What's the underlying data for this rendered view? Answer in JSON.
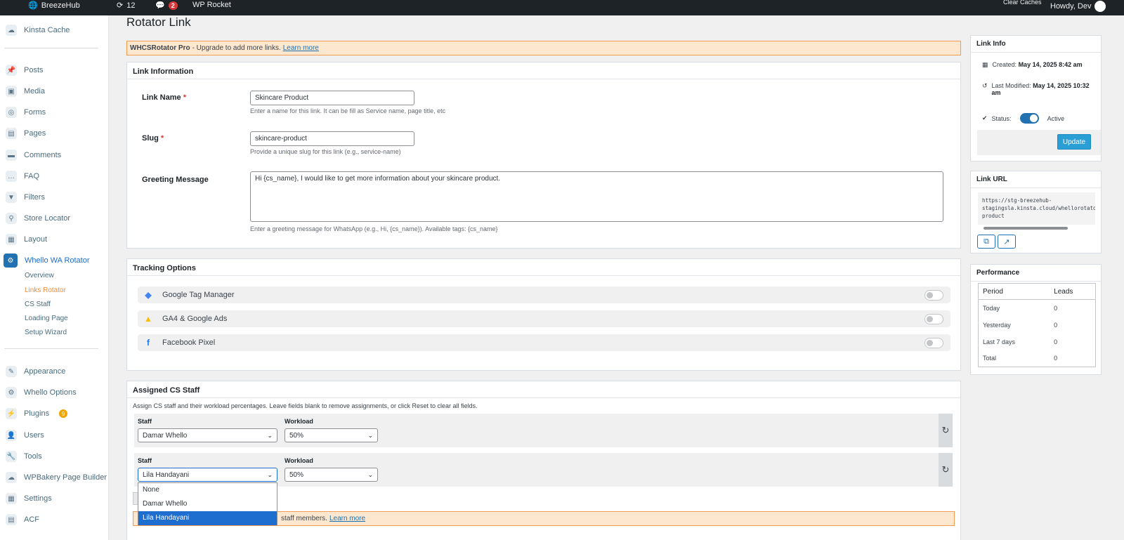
{
  "topbar": {
    "site": "BreezeHub",
    "updates": "12",
    "comments": "2",
    "rocket": "WP Rocket",
    "clear": "Clear Caches",
    "howdy": "Howdy, Dev"
  },
  "sidebar": {
    "kinsta": "Kinsta Cache",
    "items": [
      "Posts",
      "Media",
      "Forms",
      "Pages",
      "Comments",
      "FAQ",
      "Filters",
      "Store Locator",
      "Layout"
    ],
    "active": "Whello WA Rotator",
    "subs": [
      "Overview",
      "Links Rotator",
      "CS Staff",
      "Loading Page",
      "Setup Wizard"
    ],
    "items2": [
      "Appearance",
      "Whello Options",
      "Plugins",
      "Users",
      "Tools",
      "WPBakery Page Builder",
      "Settings",
      "ACF"
    ],
    "plugins_badge": "9"
  },
  "page": {
    "title": "Rotator Link",
    "notice_brand": "WHCSRotator Pro",
    "notice_text": " - Upgrade to add more links.",
    "notice_link": "Learn more"
  },
  "link_info_box": {
    "header": "Link Information",
    "name_label": "Link Name",
    "name_value": "Skincare Product",
    "name_help": "Enter a name for this link. It can be fill as Service name, page title, etc",
    "slug_label": "Slug",
    "slug_value": "skincare-product",
    "slug_help": "Provide a unique slug for this link (e.g., service-name)",
    "greet_label": "Greeting Message",
    "greet_value": "Hi {cs_name}, I would like to get more information about your skincare product.",
    "greet_help": "Enter a greeting message for WhatsApp (e.g., Hi, {cs_name}). Available tags: {cs_name}",
    "required_mark": "*"
  },
  "tracking": {
    "header": "Tracking Options",
    "items": [
      "Google Tag Manager",
      "GA4 & Google Ads",
      "Facebook Pixel"
    ]
  },
  "staff": {
    "header": "Assigned CS Staff",
    "intro": "Assign CS staff and their workload percentages. Leave fields blank to remove assignments, or click Reset to clear all fields.",
    "staff_label": "Staff",
    "workload_label": "Workload",
    "row1_staff": "Damar Whello",
    "row1_workload": "50%",
    "row2_staff": "Lila Handayani",
    "row2_workload": "50%",
    "dropdown": [
      "None",
      "Damar Whello",
      "Lila Handayani"
    ],
    "notice_text": "staff members.",
    "notice_link": "Learn more"
  },
  "right": {
    "info_header": "Link Info",
    "created_label": "Created:",
    "created_value": "May 14, 2025 8:42 am",
    "modified_label": "Last Modified:",
    "modified_value": "May 14, 2025 10:32",
    "modified_value2": "am",
    "status_label": "Status:",
    "status_value": "Active",
    "update": "Update",
    "url_header": "Link URL",
    "url_line1": "https://stg-breezehub-",
    "url_line2": "stagingsla.kinsta.cloud/whellorotator/skincare-",
    "url_line3": "product",
    "perf_header": "Performance",
    "perf_cols": [
      "Period",
      "Leads"
    ],
    "perf_rows": [
      [
        "Today",
        "0"
      ],
      [
        "Yesterday",
        "0"
      ],
      [
        "Last 7 days",
        "0"
      ],
      [
        "Total",
        "0"
      ]
    ]
  },
  "colors": {
    "accent": "#2271b1",
    "notice_bg": "#fde8cf",
    "active_sub": "#f08c3a"
  }
}
